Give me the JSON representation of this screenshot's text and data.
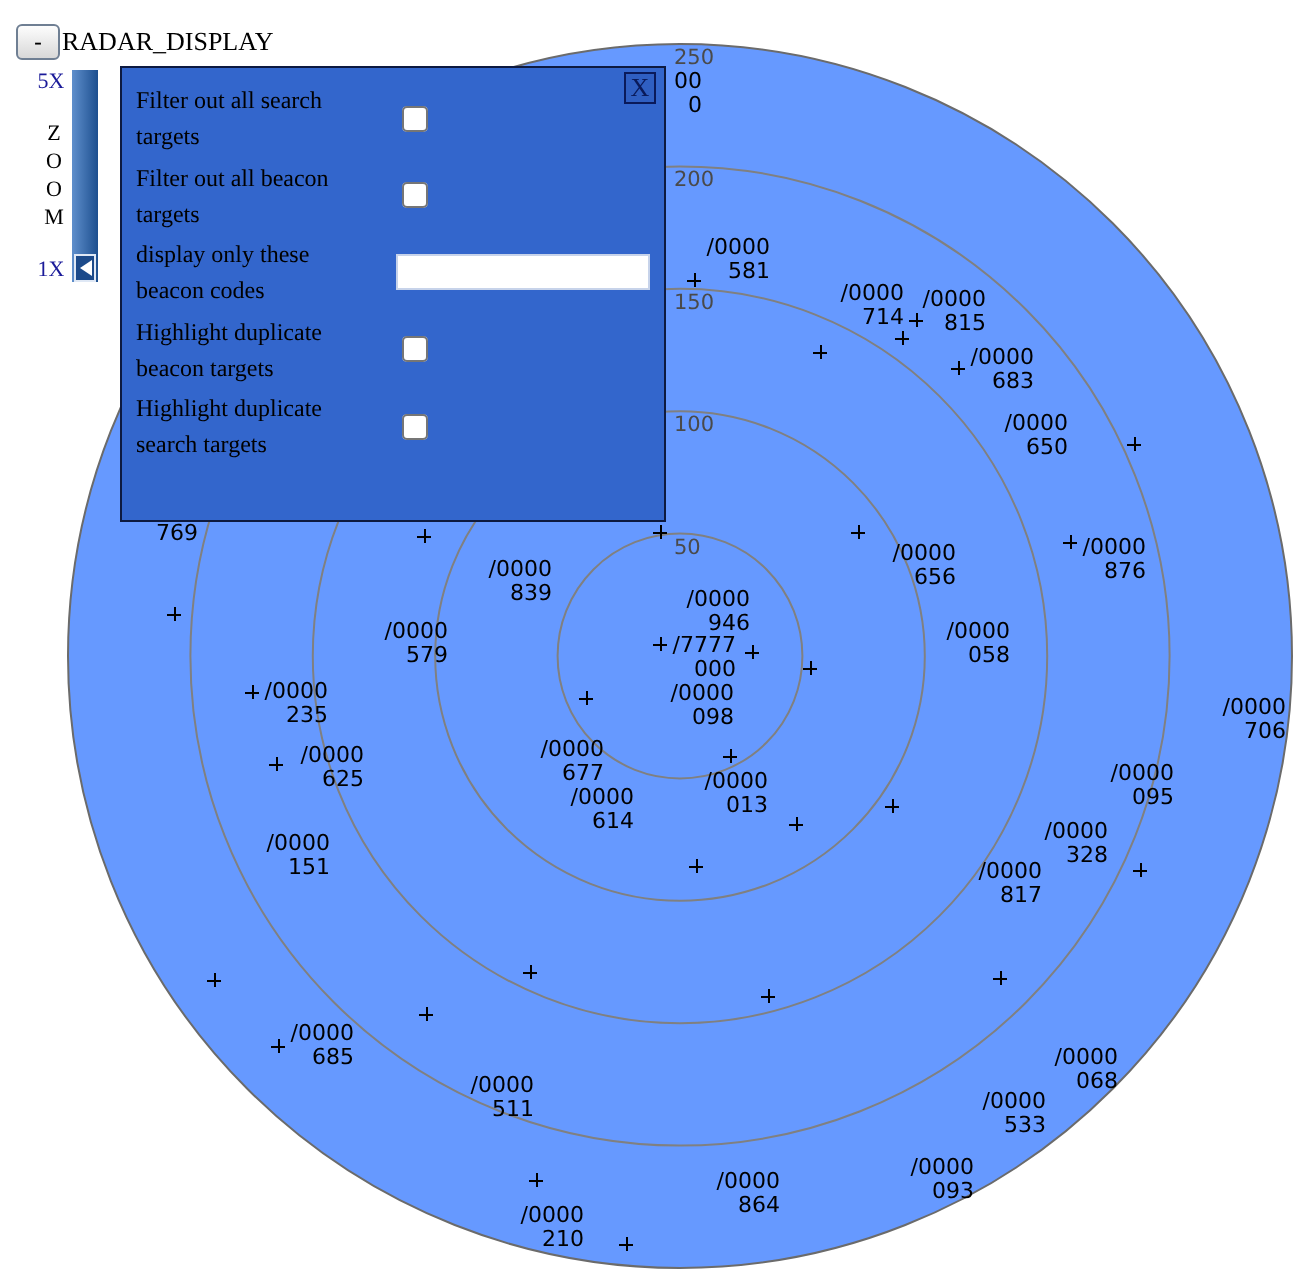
{
  "header": {
    "collapse_button": "-",
    "title": "RADAR_DISPLAY"
  },
  "zoom": {
    "max_label": "5X",
    "caption": "ZOOM",
    "min_label": "1X",
    "level": 0
  },
  "filter_panel": {
    "close_button": "X",
    "options": [
      {
        "kind": "checkbox",
        "label": "Filter out all search targets",
        "checked": false
      },
      {
        "kind": "checkbox",
        "label": "Filter out all beacon targets",
        "checked": false
      },
      {
        "kind": "text",
        "label": "display only these beacon codes"
      },
      {
        "kind": "checkbox",
        "label": "Highlight duplicate beacon targets",
        "checked": false
      },
      {
        "kind": "checkbox",
        "label": "Highlight duplicate search targets",
        "checked": false
      }
    ]
  },
  "radar": {
    "range_rings": [
      "250",
      "200",
      "150",
      "100",
      "50"
    ],
    "targets": [
      {
        "code": "00",
        "number": "0"
      },
      {
        "code": "/0000",
        "number": "581"
      },
      {
        "code": "/0000",
        "number": "714"
      },
      {
        "code": "/0000",
        "number": "815"
      },
      {
        "code": "/0000",
        "number": "683"
      },
      {
        "code": "/0000",
        "number": "650"
      },
      {
        "number": "769"
      },
      {
        "code": "/0000",
        "number": "876"
      },
      {
        "code": "/0000",
        "number": "656"
      },
      {
        "code": "/0000",
        "number": "839"
      },
      {
        "code": "/0000",
        "number": "946"
      },
      {
        "code": "/0000",
        "number": "058"
      },
      {
        "code": "/0000",
        "number": "579"
      },
      {
        "code": "/7777",
        "number": "000"
      },
      {
        "code": "/0000",
        "number": "098"
      },
      {
        "code": "/0000",
        "number": "235"
      },
      {
        "code": "/0000",
        "number": "706"
      },
      {
        "code": "/0000",
        "number": "677"
      },
      {
        "code": "/0000",
        "number": "625"
      },
      {
        "code": "/0000",
        "number": "095"
      },
      {
        "code": "/0000",
        "number": "013"
      },
      {
        "code": "/0000",
        "number": "614"
      },
      {
        "code": "/0000",
        "number": "328"
      },
      {
        "code": "/0000",
        "number": "151"
      },
      {
        "code": "/0000",
        "number": "817"
      },
      {
        "code": "/0000",
        "number": "685"
      },
      {
        "code": "/0000",
        "number": "068"
      },
      {
        "code": "/0000",
        "number": "511"
      },
      {
        "code": "/0000",
        "number": "533"
      },
      {
        "code": "/0000",
        "number": "093"
      },
      {
        "code": "/0000",
        "number": "864"
      },
      {
        "code": "/0000",
        "number": "210"
      }
    ]
  }
}
